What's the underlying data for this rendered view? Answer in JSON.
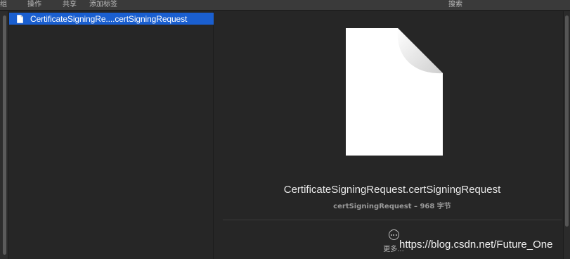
{
  "toolbar": {
    "group_label": "组",
    "action_label": "操作",
    "share_label": "共享",
    "add_tags_label": "添加标签",
    "search_label": "搜索"
  },
  "file_list": {
    "items": [
      {
        "name": "CertificateSigningRe....certSigningRequest",
        "icon": "document-icon",
        "selected": true
      }
    ]
  },
  "preview": {
    "file_title": "CertificateSigningRequest.certSigningRequest",
    "meta": "certSigningRequest – 968 字节",
    "icon": "document-icon",
    "more_label": "更多..."
  },
  "watermark": "https://blog.csdn.net/Future_One",
  "colors": {
    "selection": "#1a5fd0",
    "background": "#262626",
    "toolbar": "#3a3a3a"
  }
}
